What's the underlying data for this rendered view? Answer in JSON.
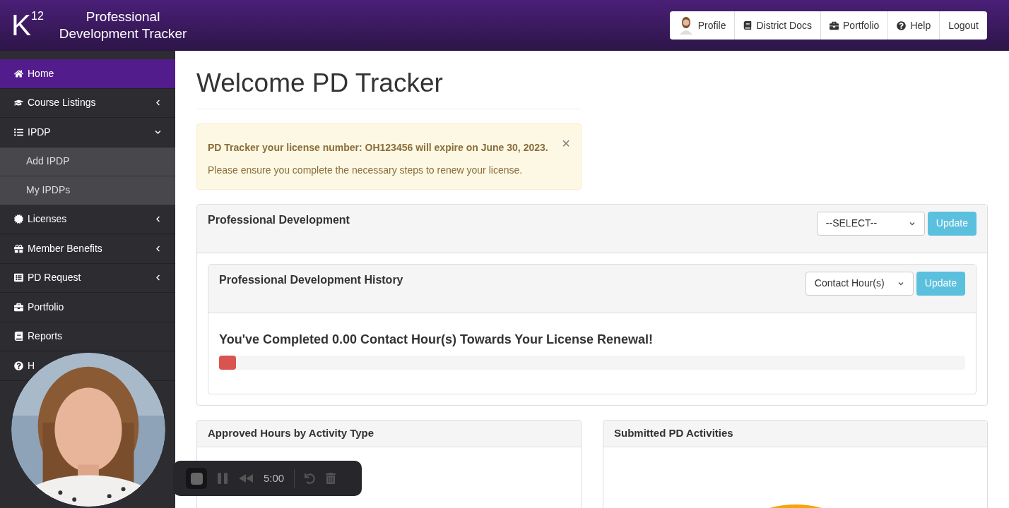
{
  "logo": {
    "mark": "K",
    "superscript": "12",
    "title_line_1": "Professional",
    "title_line_2": "Development Tracker"
  },
  "nav": [
    "Profile",
    "District Docs",
    "Portfolio",
    "Help",
    "Logout"
  ],
  "sidebar": {
    "items": [
      {
        "label": "Home",
        "selected": true
      },
      {
        "label": "Course Listings",
        "selected": false,
        "expanded": false
      },
      {
        "label": "IPDP",
        "selected": false,
        "expanded": true,
        "children": [
          {
            "label": "Add IPDP",
            "selected": false
          },
          {
            "label": "My IPDPs",
            "selected": false
          }
        ]
      },
      {
        "label": "Licenses",
        "selected": false,
        "expanded": false
      },
      {
        "label": "Member Benefits",
        "selected": false,
        "expanded": false
      },
      {
        "label": "PD Request",
        "selected": false,
        "expanded": false
      },
      {
        "label": "Portfolio",
        "selected": false
      },
      {
        "label": "Reports",
        "selected": false
      },
      {
        "label": "H",
        "selected": false
      }
    ]
  },
  "page_title": "Welcome PD Tracker",
  "alert": {
    "title": "PD Tracker your license number: OH123456 will expire on June 30, 2023.",
    "message": "Please ensure you complete the necessary steps to renew your license.",
    "close": "×"
  },
  "pd_panel": {
    "title": "Professional Development",
    "select": "--SELECT--",
    "button": "Update",
    "history": {
      "title": "Professional Development History",
      "select": "Contact Hour(s)",
      "button": "Update",
      "completed": "You've Completed 0.00 Contact Hour(s) Towards Your License Renewal!",
      "level": 0.023
    }
  },
  "panels": [
    {
      "title": "Approved Hours by Activity Type"
    },
    {
      "title": "Submitted PD Activities",
      "kind": "picture"
    }
  ],
  "recorder": {
    "time": "5:00"
  }
}
